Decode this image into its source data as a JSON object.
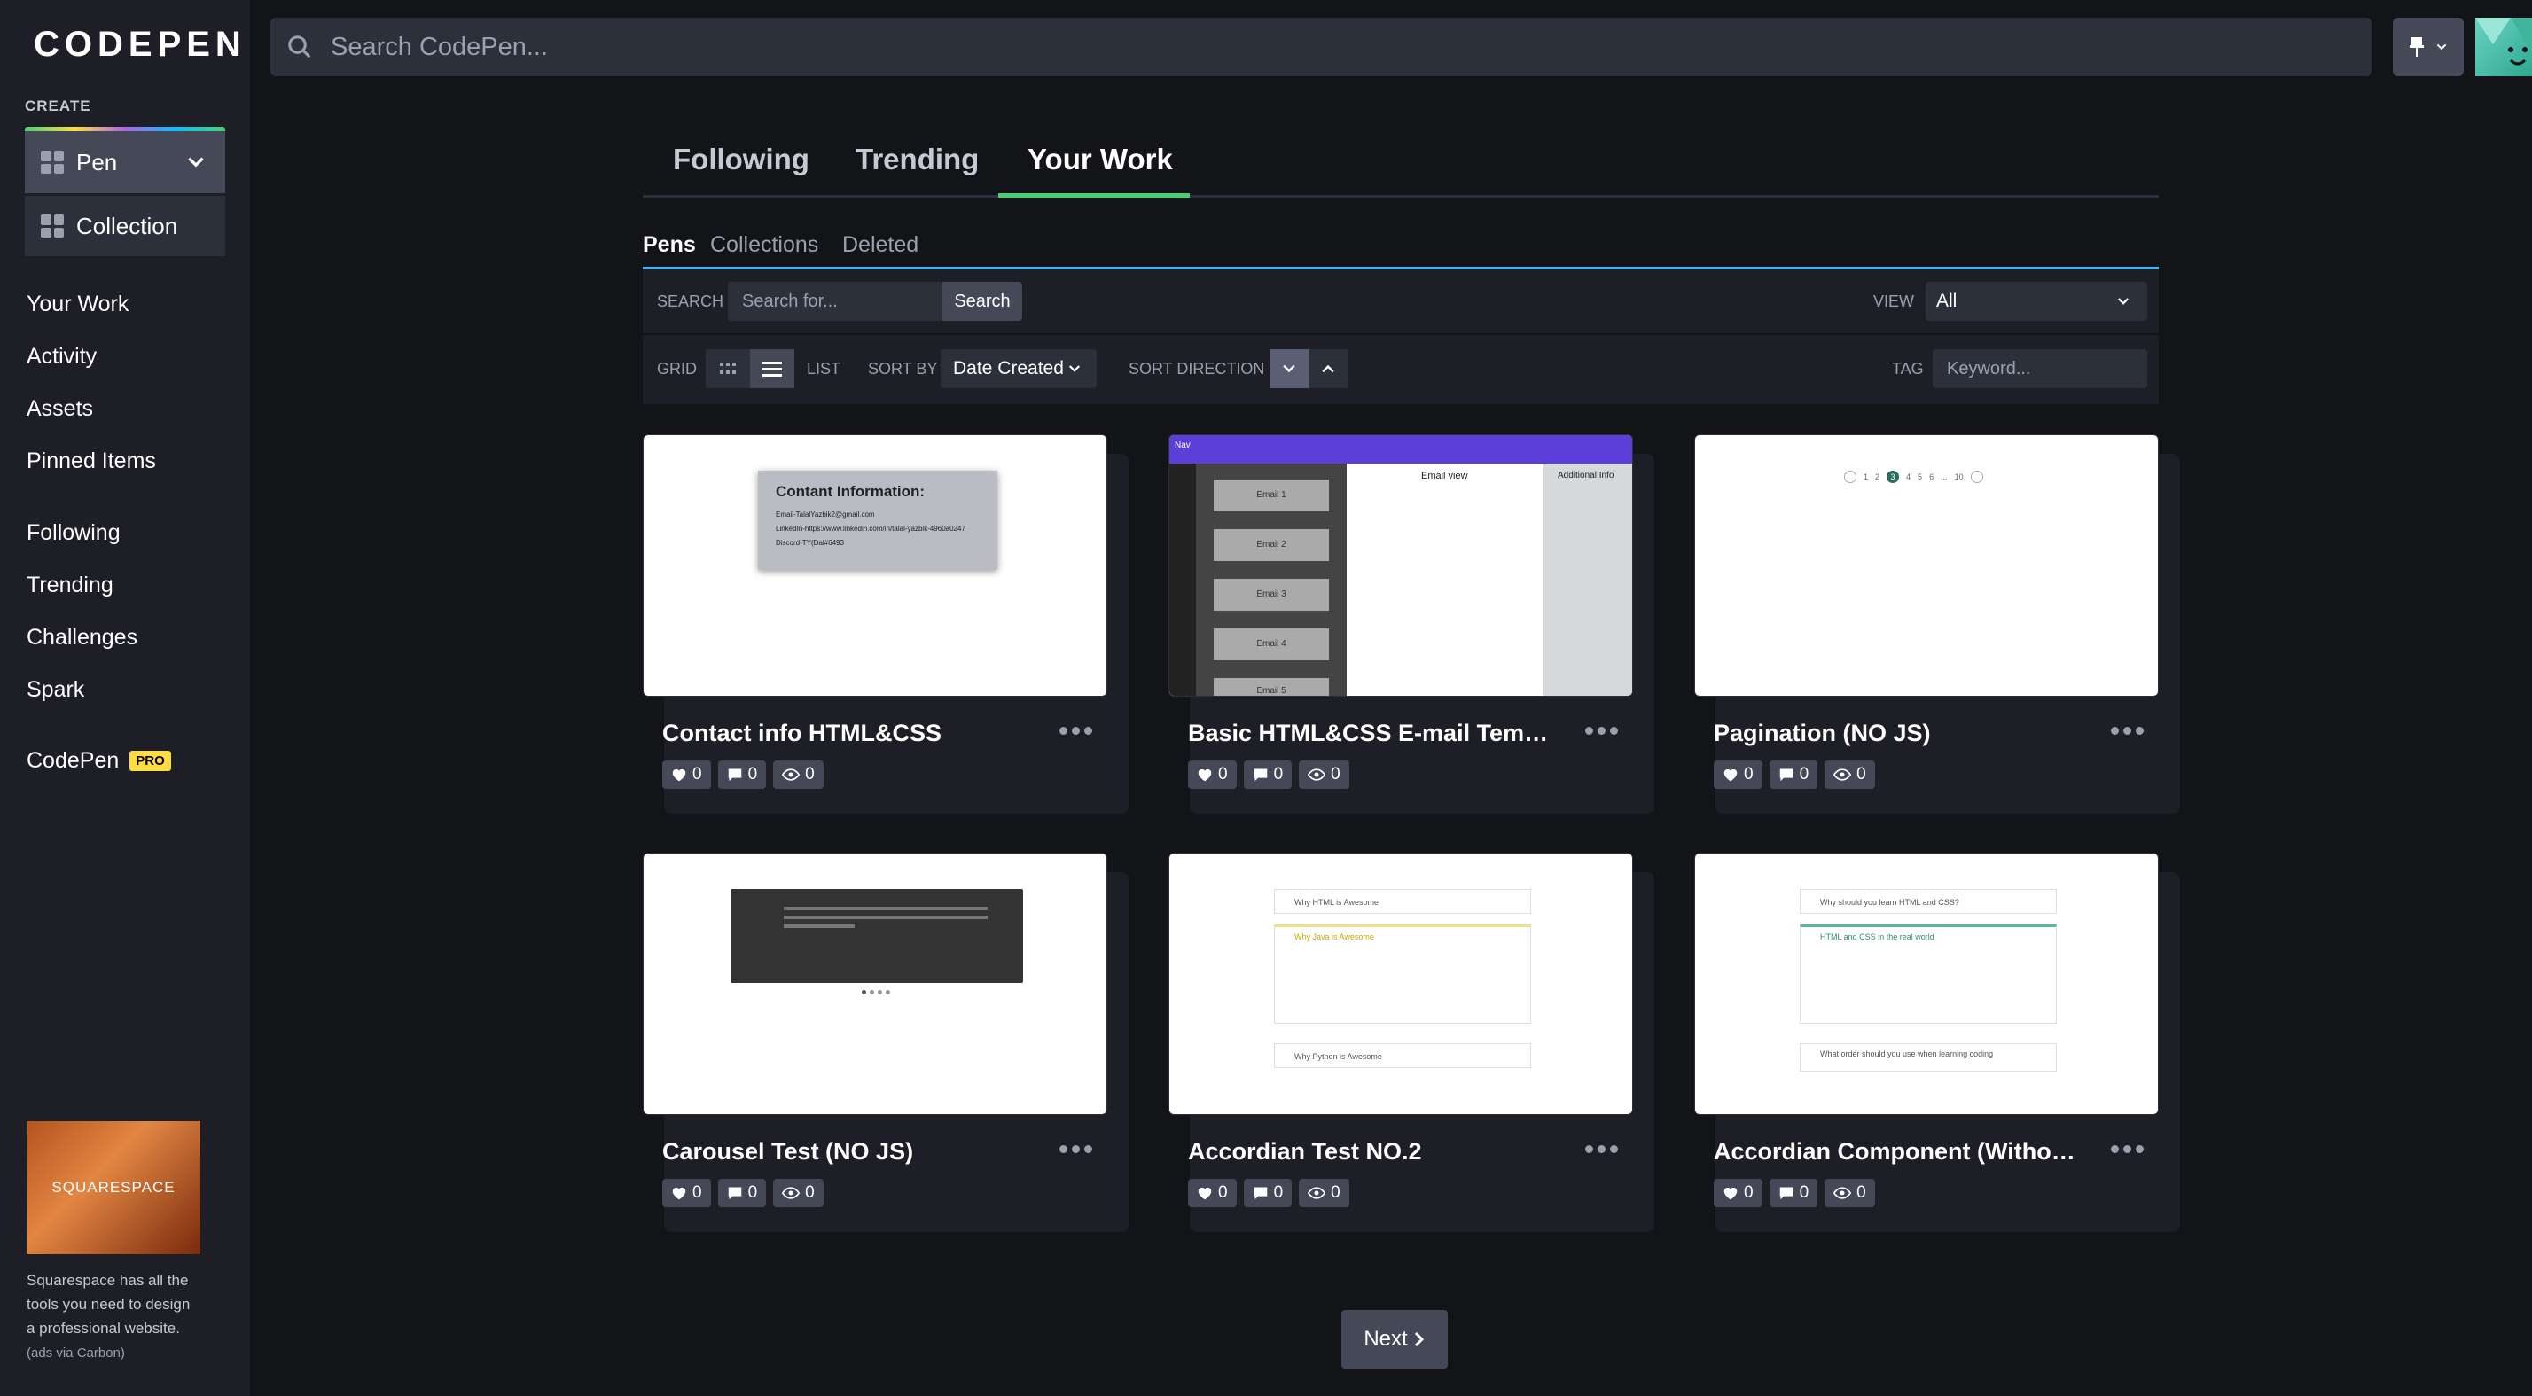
{
  "brand": {
    "name": "CODEPEN"
  },
  "sidebar": {
    "create_label": "CREATE",
    "create_items": [
      {
        "label": "Pen"
      },
      {
        "label": "Collection"
      }
    ],
    "nav_primary": [
      "Your Work",
      "Activity",
      "Assets",
      "Pinned Items"
    ],
    "nav_secondary": [
      "Following",
      "Trending",
      "Challenges",
      "Spark"
    ],
    "codepen_pro": {
      "label": "CodePen",
      "badge": "PRO"
    },
    "ad": {
      "brand": "SQUARESPACE",
      "text": "Squarespace has all the tools you need to design a professional website.",
      "via": "(ads via Carbon)"
    }
  },
  "topbar": {
    "search_placeholder": "Search CodePen..."
  },
  "main_tabs": [
    "Following",
    "Trending",
    "Your Work"
  ],
  "active_main_tab": "Your Work",
  "sub_tabs": [
    "Pens",
    "Collections",
    "Deleted"
  ],
  "active_sub_tab": "Pens",
  "controls": {
    "search_label": "SEARCH",
    "search_placeholder": "Search for...",
    "search_button": "Search",
    "view_label": "VIEW",
    "view_value": "All",
    "grid_label": "GRID",
    "list_label": "LIST",
    "sort_by_label": "SORT BY",
    "sort_by_value": "Date Created",
    "sort_direction_label": "SORT DIRECTION",
    "tag_label": "TAG",
    "tag_placeholder": "Keyword..."
  },
  "pens": [
    {
      "title": "Contact info HTML&CSS",
      "likes": "0",
      "comments": "0",
      "views": "0"
    },
    {
      "title": "Basic HTML&CSS E-mail Template",
      "likes": "0",
      "comments": "0",
      "views": "0"
    },
    {
      "title": "Pagination (NO JS)",
      "likes": "0",
      "comments": "0",
      "views": "0"
    },
    {
      "title": "Carousel Test (NO JS)",
      "likes": "0",
      "comments": "0",
      "views": "0"
    },
    {
      "title": "Accordian Test NO.2",
      "likes": "0",
      "comments": "0",
      "views": "0"
    },
    {
      "title": "Accordian Component (Without ...",
      "likes": "0",
      "comments": "0",
      "views": "0"
    }
  ],
  "thumbs": {
    "contact": {
      "title": "Contant Information:",
      "lines": [
        "Email-TalalYazbik2@gmail.com",
        "LinkedIn-https://www.linkedin.com/in/talal-yazbik-4960a0247",
        "Discord-TY(Dal#6493"
      ]
    },
    "email": {
      "nav": "Nav",
      "view": "Email view",
      "info": "Additional Info",
      "emails": [
        "Email 1",
        "Email 2",
        "Email 3",
        "Email 4",
        "Email 5"
      ]
    },
    "pagination": {
      "pages": [
        "1",
        "2",
        "3",
        "4",
        "5",
        "6",
        "...",
        "10"
      ]
    },
    "accordion1": {
      "items": [
        "Why HTML is Awesome",
        "Why Java is Awesome",
        "Why Python is Awesome"
      ]
    },
    "accordion2": {
      "items": [
        "Why should you learn HTML and CSS?",
        "HTML and CSS in the real world",
        "What order should you use when learning coding"
      ]
    }
  },
  "pagination": {
    "next": "Next"
  },
  "colors": {
    "accent_green": "#47cf73",
    "accent_blue": "#47b0f0",
    "pro_yellow": "#ffdd40"
  }
}
